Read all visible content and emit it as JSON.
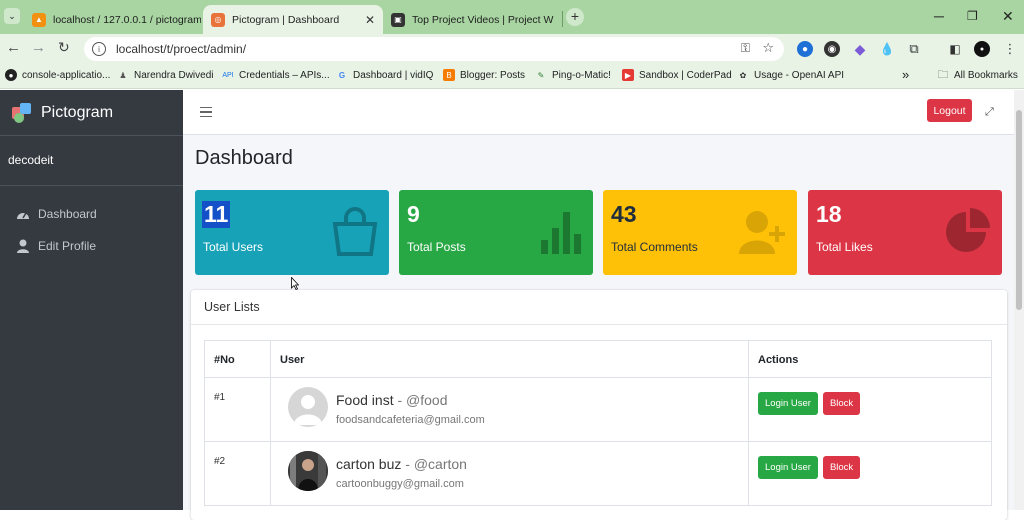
{
  "browser": {
    "tabs": [
      {
        "title": "localhost / 127.0.0.1 / pictogram",
        "favicon": "phpmyadmin-icon"
      },
      {
        "title": "Pictogram | Dashboard",
        "favicon": "pictogram-icon",
        "active": true
      },
      {
        "title": "Top Project Videos | Project W",
        "favicon": "project-icon"
      }
    ],
    "new_tab": "+",
    "url": "localhost/t/proect/admin/",
    "bookmarks": [
      {
        "label": "console-applicatio..."
      },
      {
        "label": "Narendra Dwivedi"
      },
      {
        "label": "Credentials – APIs..."
      },
      {
        "label": "Dashboard | vidIQ"
      },
      {
        "label": "Blogger: Posts"
      },
      {
        "label": "Ping-o-Matic!"
      },
      {
        "label": "Sandbox | CoderPad"
      },
      {
        "label": "Usage - OpenAI API"
      }
    ],
    "more_bookmarks": "»",
    "all_bookmarks": "All Bookmarks"
  },
  "sidebar": {
    "brand": "Pictogram",
    "username": "decodeit",
    "items": [
      {
        "label": "Dashboard",
        "icon": "dashboard-icon"
      },
      {
        "label": "Edit Profile",
        "icon": "user-icon"
      }
    ]
  },
  "header": {
    "logout_label": "Logout"
  },
  "page": {
    "title": "Dashboard"
  },
  "stats": [
    {
      "value": "11",
      "label": "Total Users",
      "color": "#17a2b8",
      "icon": "shopping-bag-icon"
    },
    {
      "value": "9",
      "label": "Total Posts",
      "color": "#28a745",
      "icon": "bar-chart-icon"
    },
    {
      "value": "43",
      "label": "Total Comments",
      "color": "#ffc107",
      "icon": "user-plus-icon"
    },
    {
      "value": "18",
      "label": "Total Likes",
      "color": "#dc3545",
      "icon": "pie-chart-icon"
    }
  ],
  "users_card": {
    "title": "User Lists",
    "columns": [
      "#No",
      "User",
      "Actions"
    ],
    "rows": [
      {
        "no": "#1",
        "name": "Food inst",
        "handle": "- @food",
        "email": "foodsandcafeteria@gmail.com",
        "login_label": "Login User",
        "block_label": "Block"
      },
      {
        "no": "#2",
        "name": "carton buz",
        "handle": "- @carton",
        "email": "cartoonbuggy@gmail.com",
        "login_label": "Login User",
        "block_label": "Block"
      }
    ]
  }
}
